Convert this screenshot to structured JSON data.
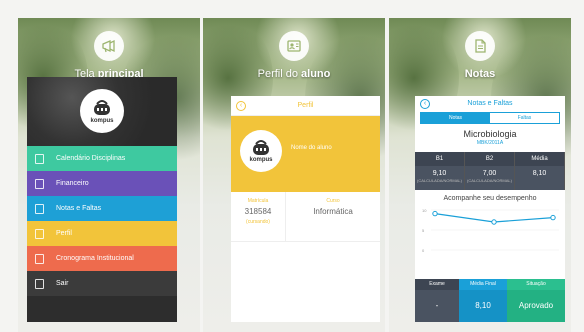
{
  "colors": {
    "menu": [
      "#3ec9a0",
      "#6a51b8",
      "#1ea0d6",
      "#f2c43a",
      "#ee6b4d",
      "#3b3b3b"
    ],
    "yellow": "#f2c43a",
    "blue": "#1aa0d8",
    "green": "#2bbf8f"
  },
  "panels": [
    {
      "title_pre": "Tela ",
      "title_bold": "principal",
      "icon": "megaphone-icon"
    },
    {
      "title_pre": "Perfil do ",
      "title_bold": "aluno",
      "icon": "id-card-icon"
    },
    {
      "title_pre": "",
      "title_bold": "Notas",
      "icon": "document-icon"
    }
  ],
  "main_screen": {
    "logo_label": "kompus",
    "menu": [
      {
        "label": "Calendário Disciplinas",
        "icon": "calendar-list-icon"
      },
      {
        "label": "Financeiro",
        "icon": "building-icon"
      },
      {
        "label": "Notas e Faltas",
        "icon": "notes-icon"
      },
      {
        "label": "Perfil",
        "icon": "profile-card-icon"
      },
      {
        "label": "Cronograma Institucional",
        "icon": "calendar-icon"
      },
      {
        "label": "Sair",
        "icon": "exit-icon"
      }
    ]
  },
  "profile_screen": {
    "back": "‹",
    "bar_title": "Perfil",
    "logo_label": "kompus",
    "name_placeholder": "Nome do aluno",
    "matricula_label": "Matrícula",
    "matricula_value": "318584",
    "matricula_status": "(cursando)",
    "curso_label": "Curso",
    "curso_value": "Informática"
  },
  "grades_screen": {
    "back": "‹",
    "bar_title": "Notas e Faltas",
    "tab_notas": "Notas",
    "tab_faltas": "Faltas",
    "discipline": "Microbiologia",
    "discipline_code": "MBK/2011A",
    "grades": [
      {
        "label": "B1",
        "value": "9,10",
        "sub": "(CALCULADA/NORMAL)"
      },
      {
        "label": "B2",
        "value": "7,00",
        "sub": "(CALCULADA/NORMAL)"
      },
      {
        "label": "Média",
        "value": "8,10",
        "sub": ""
      }
    ],
    "perf_title": "Acompanhe seu desempenho",
    "footer": {
      "exame_label": "Exame",
      "exame_value": "-",
      "media_final_label": "Média Final",
      "media_final_value": "8,10",
      "situacao_label": "Situação",
      "situacao_value": "Aprovado"
    }
  },
  "chart_data": {
    "type": "line",
    "title": "Acompanhe seu desempenho",
    "x": [
      1,
      2,
      3
    ],
    "series": [
      {
        "values": [
          9.1,
          7.0,
          8.1
        ]
      }
    ],
    "y_ticks": [
      10,
      5,
      0
    ],
    "ylim": [
      0,
      10
    ]
  }
}
